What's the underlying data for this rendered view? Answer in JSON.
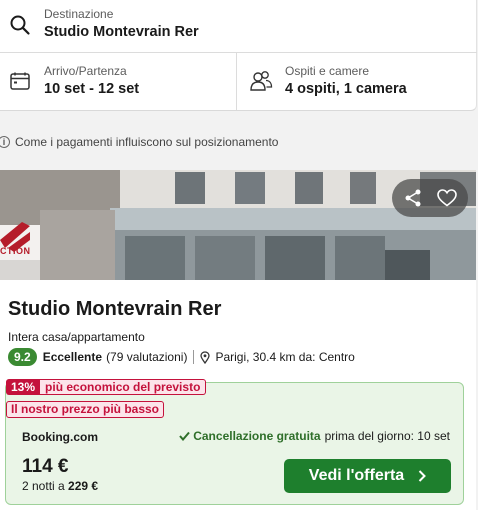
{
  "search": {
    "destination_label": "Destinazione",
    "destination_value": "Studio Montevrain Rer",
    "dates_label": "Arrivo/Partenza",
    "dates_value": "10 set - 12 set",
    "guests_label": "Ospiti e camere",
    "guests_value": "4 ospiti, 1 camera"
  },
  "info_text": "Come i pagamenti influiscono sul posizionamento",
  "hotel": {
    "name": "Studio Montevrain Rer",
    "type": "Intera casa/appartamento",
    "score": "9.2",
    "rating_word": "Eccellente",
    "reviews": "(79 valutazioni)",
    "location": "Parigi, 30.4 km da: Centro",
    "photo_sign_text": "CTION"
  },
  "deal": {
    "pct_tag": "13%",
    "pct_text": "più economico del previsto",
    "lowest_price_tag": "Il nostro prezzo più basso",
    "provider": "Booking.com",
    "cancel_bold": "Cancellazione gratuita",
    "cancel_rest": "prima del giorno: 10 set",
    "price": "114 €",
    "nights_prefix": "2 notti a",
    "nights_total": "229 €",
    "button_label": "Vedi l'offerta"
  },
  "colors": {
    "score_green": "#3a8a32",
    "deal_bg": "#eaf5e7",
    "button_green": "#1e7f2d",
    "tag_red": "#c4123c"
  },
  "icons": [
    "search-icon",
    "calendar-icon",
    "guests-icon",
    "info-icon",
    "share-icon",
    "heart-icon",
    "location-pin-icon",
    "check-icon",
    "chevron-right-icon"
  ]
}
